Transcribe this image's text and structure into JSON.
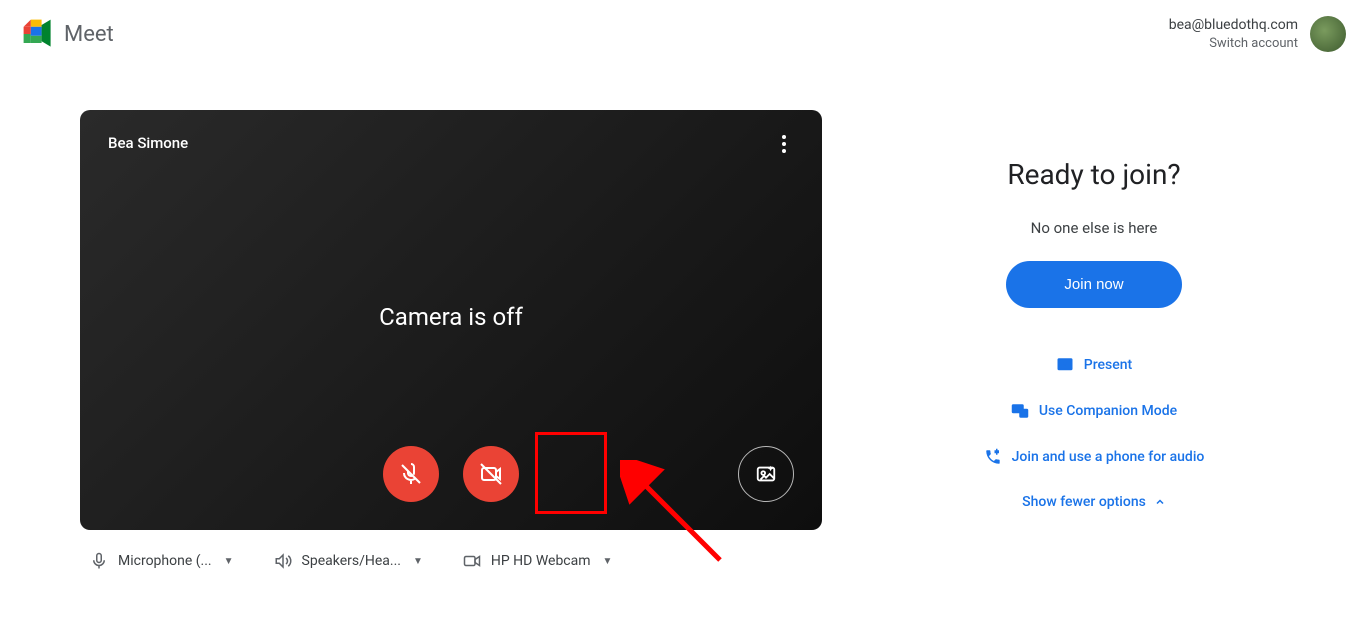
{
  "header": {
    "app_name": "Meet",
    "email": "bea@bluedothq.com",
    "switch_label": "Switch account"
  },
  "preview": {
    "participant_name": "Bea Simone",
    "camera_off_text": "Camera is off"
  },
  "devices": {
    "mic": "Microphone (...",
    "speaker": "Speakers/Hea...",
    "camera": "HP HD Webcam"
  },
  "join": {
    "title": "Ready to join?",
    "subtext": "No one else is here",
    "join_label": "Join now",
    "present_label": "Present",
    "companion_label": "Use Companion Mode",
    "phone_label": "Join and use a phone for audio",
    "toggle_label": "Show fewer options"
  }
}
